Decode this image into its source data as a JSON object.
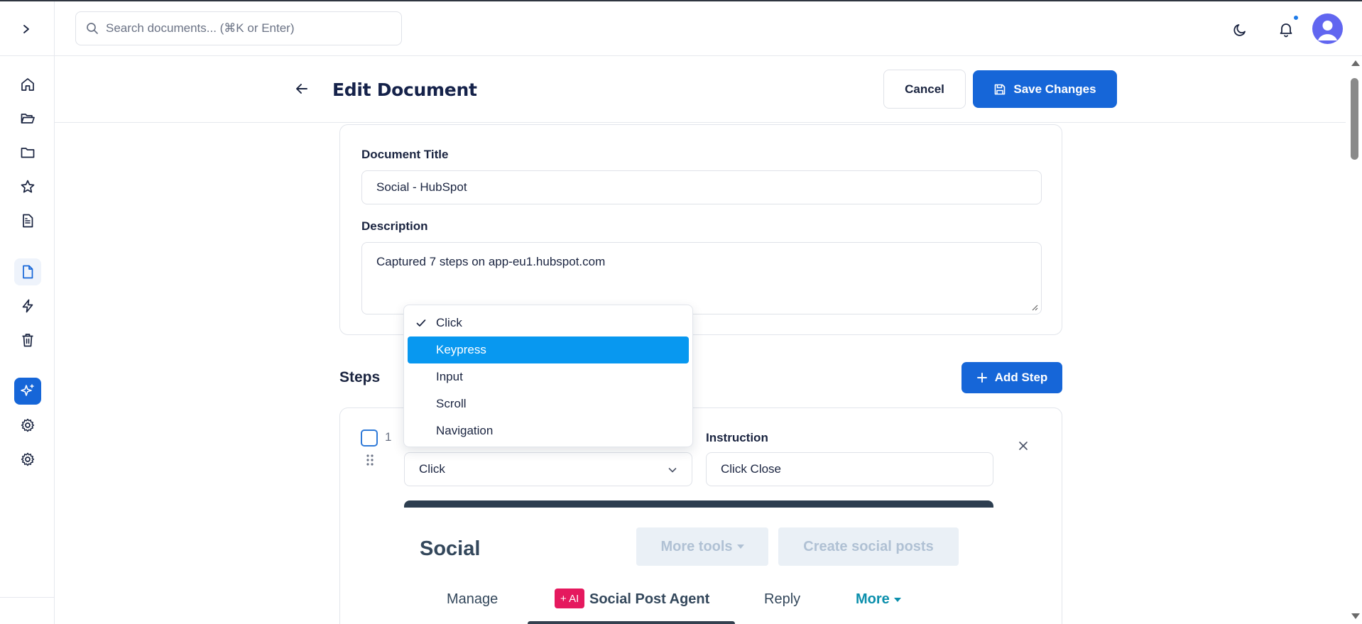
{
  "search": {
    "placeholder": "Search documents... (⌘K or Enter)"
  },
  "header": {
    "title": "Edit Document",
    "cancel_label": "Cancel",
    "save_label": "Save Changes"
  },
  "sidebar": {
    "items": [
      {
        "name": "home-icon"
      },
      {
        "name": "folder-open-icon"
      },
      {
        "name": "folder-icon"
      },
      {
        "name": "star-icon"
      },
      {
        "name": "document-text-icon"
      },
      {
        "name": "file-icon",
        "active": true
      },
      {
        "name": "lightning-icon"
      },
      {
        "name": "trash-icon"
      },
      {
        "name": "ai-sparkle-icon"
      },
      {
        "name": "gear-icon"
      },
      {
        "name": "settings-icon"
      }
    ]
  },
  "form": {
    "title_label": "Document Title",
    "title_value": "Social - HubSpot",
    "description_label": "Description",
    "description_value": "Captured 7 steps on app-eu1.hubspot.com"
  },
  "steps": {
    "heading": "Steps",
    "add_label": "Add Step",
    "items": [
      {
        "number": "1",
        "action": "Click",
        "instruction_label": "Instruction",
        "instruction_value": "Click Close"
      }
    ]
  },
  "dropdown": {
    "options": [
      "Click",
      "Keypress",
      "Input",
      "Scroll",
      "Navigation"
    ],
    "selected": "Click",
    "highlighted": "Keypress"
  },
  "preview": {
    "title": "Social",
    "more_tools": "More tools",
    "create_posts": "Create social posts",
    "tabs": [
      "Manage",
      "Social Post Agent",
      "Reply",
      "More"
    ],
    "ai_badge": "+ AI"
  },
  "colors": {
    "primary": "#1666d8",
    "highlight": "#0898f0",
    "notification_dot": "#1e7be8",
    "avatar": "#6166f0",
    "ai_badge": "#e5195e"
  }
}
